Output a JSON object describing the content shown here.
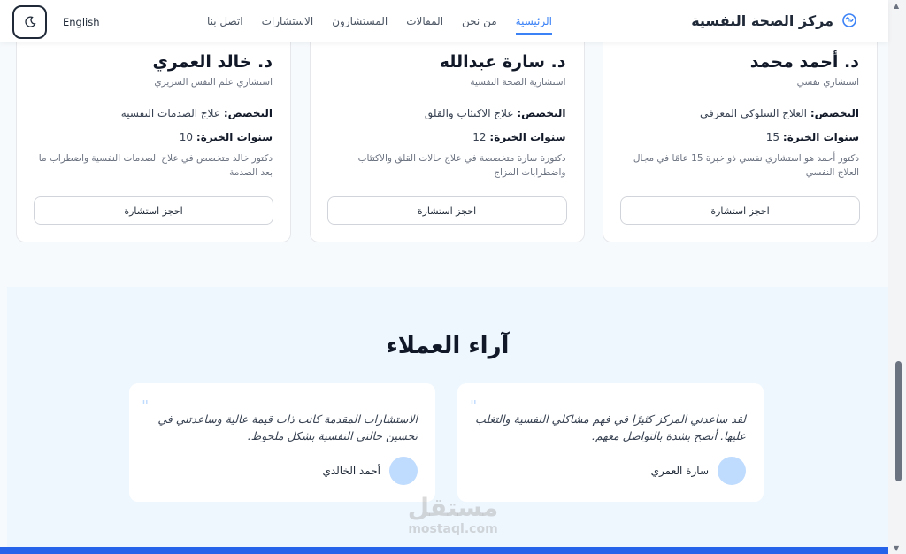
{
  "header": {
    "brand_name": "مركز الصحة النفسية",
    "nav": [
      {
        "label": "الرئيسية",
        "active": true
      },
      {
        "label": "من نحن",
        "active": false
      },
      {
        "label": "المقالات",
        "active": false
      },
      {
        "label": "المستشارون",
        "active": false
      },
      {
        "label": "الاستشارات",
        "active": false
      },
      {
        "label": "اتصل بنا",
        "active": false
      }
    ],
    "language": "English",
    "theme_icon": "moon-icon"
  },
  "doctors": [
    {
      "name": "د. أحمد محمد",
      "title": "استشاري نفسي",
      "specialty_label": "التخصص:",
      "specialty": "العلاج السلوكي المعرفي",
      "years_label": "سنوات الخبرة:",
      "years": "15",
      "description": "دكتور أحمد هو استشاري نفسي ذو خبرة 15 عامًا في مجال العلاج النفسي",
      "button": "احجز استشارة"
    },
    {
      "name": "د. سارة عبدالله",
      "title": "استشارية الصحة النفسية",
      "specialty_label": "التخصص:",
      "specialty": "علاج الاكتئاب والقلق",
      "years_label": "سنوات الخبرة:",
      "years": "12",
      "description": "دكتورة سارة متخصصة في علاج حالات القلق والاكتئاب واضطرابات المزاج",
      "button": "احجز استشارة"
    },
    {
      "name": "د. خالد العمري",
      "title": "استشاري علم النفس السريري",
      "specialty_label": "التخصص:",
      "specialty": "علاج الصدمات النفسية",
      "years_label": "سنوات الخبرة:",
      "years": "10",
      "description": "دكتور خالد متخصص في علاج الصدمات النفسية واضطراب ما بعد الصدمة",
      "button": "احجز استشارة"
    }
  ],
  "testimonials": {
    "title": "آراء العملاء",
    "items": [
      {
        "text": "لقد ساعدني المركز كثيرًا في فهم مشاكلي النفسية والتغلب عليها. أنصح بشدة بالتواصل معهم.",
        "author": "سارة العمري"
      },
      {
        "text": "الاستشارات المقدمة كانت ذات قيمة عالية وساعدتني في تحسين حالتي النفسية بشكل ملحوظ.",
        "author": "أحمد الخالدي"
      }
    ]
  },
  "watermark": {
    "arabic": "مستقل",
    "latin": "mostaql.com"
  },
  "colors": {
    "accent": "#3b82f6",
    "footer": "#2563eb",
    "section_bg": "#eef6fe",
    "avatar": "#bfdbfe"
  }
}
